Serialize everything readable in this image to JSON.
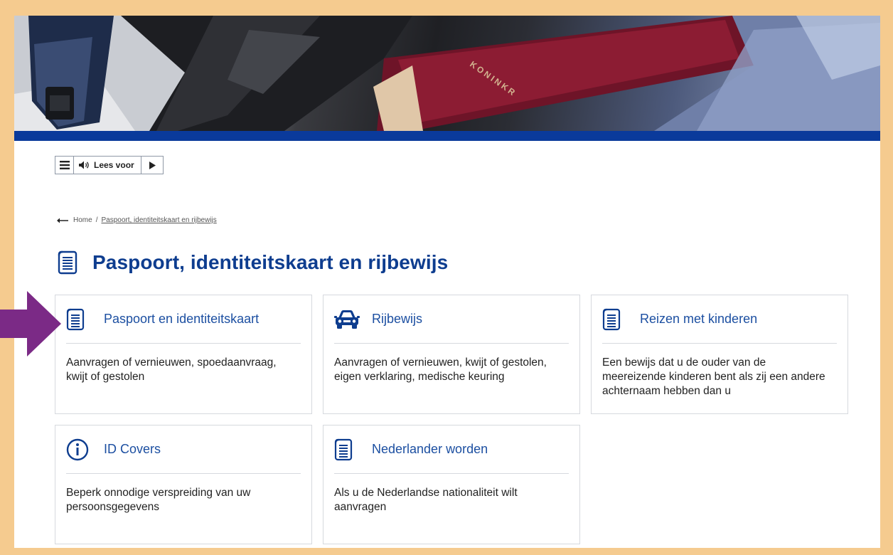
{
  "reader": {
    "menu_icon": "hamburger-icon",
    "speaker_icon": "speaker-icon",
    "label": "Lees voor",
    "play_icon": "play-icon"
  },
  "breadcrumb": {
    "back_icon": "arrow-left-icon",
    "home": "Home",
    "separator": "/",
    "current": "Paspoort, identiteitskaart en rijbewijs"
  },
  "page": {
    "icon": "document-icon",
    "title": "Paspoort, identiteitskaart en rijbewijs"
  },
  "cards": [
    {
      "icon": "document-icon",
      "title": "Paspoort en identiteitskaart",
      "description": "Aanvragen of vernieuwen, spoedaanvraag, kwijt of gestolen"
    },
    {
      "icon": "car-icon",
      "title": "Rijbewijs",
      "description": "Aanvragen of vernieuwen, kwijt of gestolen, eigen verklaring, medische keuring"
    },
    {
      "icon": "document-icon",
      "title": "Reizen met kinderen",
      "description": "Een bewijs dat u de ouder van de meereizende kinderen bent als zij een andere achternaam hebben dan u"
    },
    {
      "icon": "info-icon",
      "title": "ID Covers",
      "description": "Beperk onnodige verspreiding van uw persoonsgegevens"
    },
    {
      "icon": "document-icon",
      "title": "Nederlander worden",
      "description": "Als u de Nederlandse nationaliteit wilt aanvragen"
    }
  ],
  "annotation": {
    "icon": "arrow-right-icon",
    "color": "#7b2a86"
  },
  "colors": {
    "brand_blue": "#0a3a9b",
    "title_blue": "#0e3d8f",
    "link_blue": "#1c4fa1",
    "frame": "#f5cb8f"
  }
}
